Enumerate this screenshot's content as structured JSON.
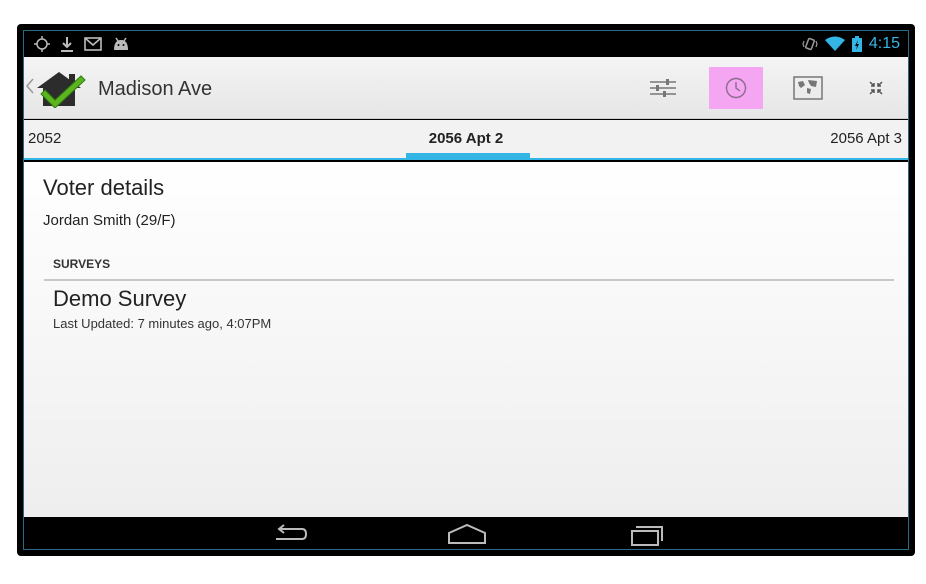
{
  "status_bar": {
    "time": "4:15",
    "left_icons": [
      "location-icon",
      "download-icon",
      "gmail-icon",
      "android-icon"
    ],
    "right_icons": [
      "vibrate-icon",
      "wifi-icon",
      "battery-icon"
    ]
  },
  "action_bar": {
    "title": "Madison Ave",
    "buttons": [
      "filter-sliders-icon",
      "history-clock-icon",
      "map-icon",
      "collapse-icon"
    ],
    "active_button": "history-clock-icon",
    "active_color": "#f4a6f2"
  },
  "tabs": {
    "left": "2052",
    "center": "2056 Apt 2",
    "right": "2056 Apt 3",
    "accent_color": "#33b5e5"
  },
  "content": {
    "title": "Voter details",
    "voter": "Jordan Smith (29/F)",
    "section_header": "SURVEYS",
    "survey": {
      "name": "Demo Survey",
      "updated_label": "Last Updated:",
      "updated_value": "7 minutes ago, 4:07PM"
    }
  },
  "nav_bar": {
    "buttons": [
      "back-icon",
      "home-icon",
      "recents-icon"
    ]
  }
}
